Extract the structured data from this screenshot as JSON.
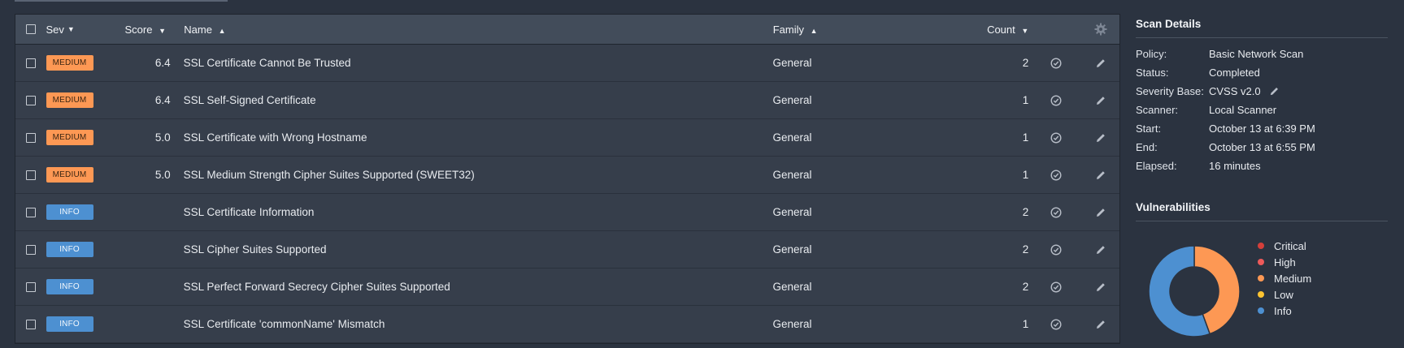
{
  "table": {
    "headers": {
      "sev": "Sev",
      "sev_sort": "▼",
      "score": "Score",
      "score_sort": "▼",
      "name": "Name",
      "name_sort": "▲",
      "family": "Family",
      "family_sort": "▲",
      "count": "Count",
      "count_sort": "▼"
    },
    "rows": [
      {
        "sev": "MEDIUM",
        "sev_level": "medium",
        "score": "6.4",
        "name": "SSL Certificate Cannot Be Trusted",
        "family": "General",
        "count": "2"
      },
      {
        "sev": "MEDIUM",
        "sev_level": "medium",
        "score": "6.4",
        "name": "SSL Self-Signed Certificate",
        "family": "General",
        "count": "1"
      },
      {
        "sev": "MEDIUM",
        "sev_level": "medium",
        "score": "5.0",
        "name": "SSL Certificate with Wrong Hostname",
        "family": "General",
        "count": "1"
      },
      {
        "sev": "MEDIUM",
        "sev_level": "medium",
        "score": "5.0",
        "name": "SSL Medium Strength Cipher Suites Supported (SWEET32)",
        "family": "General",
        "count": "1"
      },
      {
        "sev": "INFO",
        "sev_level": "info",
        "score": "",
        "name": "SSL Certificate Information",
        "family": "General",
        "count": "2"
      },
      {
        "sev": "INFO",
        "sev_level": "info",
        "score": "",
        "name": "SSL Cipher Suites Supported",
        "family": "General",
        "count": "2"
      },
      {
        "sev": "INFO",
        "sev_level": "info",
        "score": "",
        "name": "SSL Perfect Forward Secrecy Cipher Suites Supported",
        "family": "General",
        "count": "2"
      },
      {
        "sev": "INFO",
        "sev_level": "info",
        "score": "",
        "name": "SSL Certificate 'commonName' Mismatch",
        "family": "General",
        "count": "1"
      }
    ]
  },
  "scan_details": {
    "title": "Scan Details",
    "fields": [
      {
        "label": "Policy:",
        "value": "Basic Network Scan"
      },
      {
        "label": "Status:",
        "value": "Completed"
      },
      {
        "label": "Severity Base:",
        "value": "CVSS v2.0"
      },
      {
        "label": "Scanner:",
        "value": "Local Scanner"
      },
      {
        "label": "Start:",
        "value": "October 13 at 6:39 PM"
      },
      {
        "label": "End:",
        "value": "October 13 at 6:55 PM"
      },
      {
        "label": "Elapsed:",
        "value": "16 minutes"
      }
    ]
  },
  "vulnerabilities": {
    "title": "Vulnerabilities",
    "legend": [
      {
        "label": "Critical",
        "color": "#d43f3a"
      },
      {
        "label": "High",
        "color": "#ee5a5a"
      },
      {
        "label": "Medium",
        "color": "#fd9854"
      },
      {
        "label": "Low",
        "color": "#fdc431"
      },
      {
        "label": "Info",
        "color": "#4d90d1"
      }
    ],
    "chart_data": {
      "type": "pie",
      "categories": [
        "Critical",
        "High",
        "Medium",
        "Low",
        "Info"
      ],
      "values": [
        0,
        0,
        4,
        0,
        5
      ],
      "colors": [
        "#d43f3a",
        "#ee5a5a",
        "#fd9854",
        "#fdc431",
        "#4d90d1"
      ]
    }
  },
  "colors": {
    "medium": "#fd9854",
    "info": "#4d90d1",
    "background": "#2b3340"
  }
}
